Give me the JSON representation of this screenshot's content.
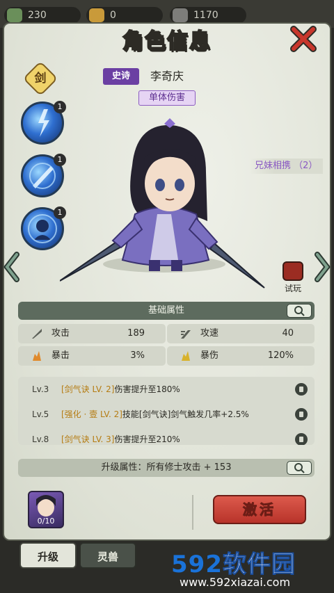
{
  "currencies": [
    {
      "value": "230",
      "icon": "jade-icon",
      "color": "#6a8f5a"
    },
    {
      "value": "0",
      "icon": "coin-icon",
      "color": "#c99a3a"
    },
    {
      "value": "1170",
      "icon": "token-icon",
      "color": "#7d7d7a"
    }
  ],
  "panel": {
    "title": "角色信息"
  },
  "hero": {
    "weapon_type": "剑",
    "rarity": "史诗",
    "name": "李奇庆",
    "role_tag": "单体伤害",
    "bond": "兄妹相携 （2）"
  },
  "skills": [
    {
      "level": "1",
      "icon": "lightning-sword-skill-icon"
    },
    {
      "level": "1",
      "icon": "sword-thrust-skill-icon"
    },
    {
      "level": "1",
      "icon": "spirit-skill-icon"
    }
  ],
  "trial": {
    "label": "试玩"
  },
  "base_attrs": {
    "title": "基础属性",
    "items": [
      {
        "name": "攻击",
        "value": "189",
        "icon": "attack-icon"
      },
      {
        "name": "攻速",
        "value": "40",
        "icon": "attack-speed-icon"
      },
      {
        "name": "暴击",
        "value": "3%",
        "icon": "crit-icon"
      },
      {
        "name": "暴伤",
        "value": "120%",
        "icon": "crit-damage-icon"
      }
    ]
  },
  "unlocks": [
    {
      "level": "Lv.3",
      "hl": "[剑气诀 LV. 2]",
      "text": "伤害提升至180%"
    },
    {
      "level": "Lv.5",
      "hl": "[强化 · 壹 LV. 2]",
      "text": "技能[剑气诀]剑气触发几率+2.5%"
    },
    {
      "level": "Lv.8",
      "hl": "[剑气诀 LV. 3]",
      "text": "伤害提升至210%"
    }
  ],
  "upgrade": {
    "text": "升级属性：所有修士攻击 + 153"
  },
  "fragments": {
    "count": "0/10"
  },
  "activate_label": "激活",
  "tabs": [
    {
      "label": "升级"
    },
    {
      "label": "灵兽"
    }
  ],
  "watermark": {
    "brand_num": "592",
    "brand_cn": "软件园",
    "url": "www.592xiazai.com"
  }
}
